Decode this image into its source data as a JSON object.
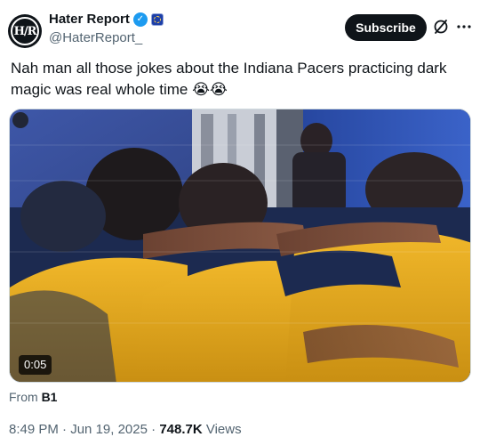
{
  "author": {
    "display_name": "Hater Report",
    "handle": "@HaterReport_",
    "avatar_text": "H∕R",
    "verified": true
  },
  "actions": {
    "subscribe_label": "Subscribe",
    "icons": [
      "grok-icon",
      "more-icon"
    ]
  },
  "tweet": {
    "text": "Nah man all those jokes about the Indiana Pacers practicing dark magic was real whole time 😭😭"
  },
  "media": {
    "type": "video",
    "duration": "0:05"
  },
  "source": {
    "from_label": "From",
    "from_name": "B1"
  },
  "meta": {
    "time": "8:49 PM",
    "sep1": " · ",
    "date": "Jun 19, 2025",
    "sep2": " · ",
    "views_count": "748.7K",
    "views_label": " Views"
  },
  "colors": {
    "verified_blue": "#1d9bf0",
    "text_primary": "#0f1419",
    "text_secondary": "#536471",
    "pacers_gold": "#e8a818",
    "pacers_navy": "#1c2a50"
  }
}
